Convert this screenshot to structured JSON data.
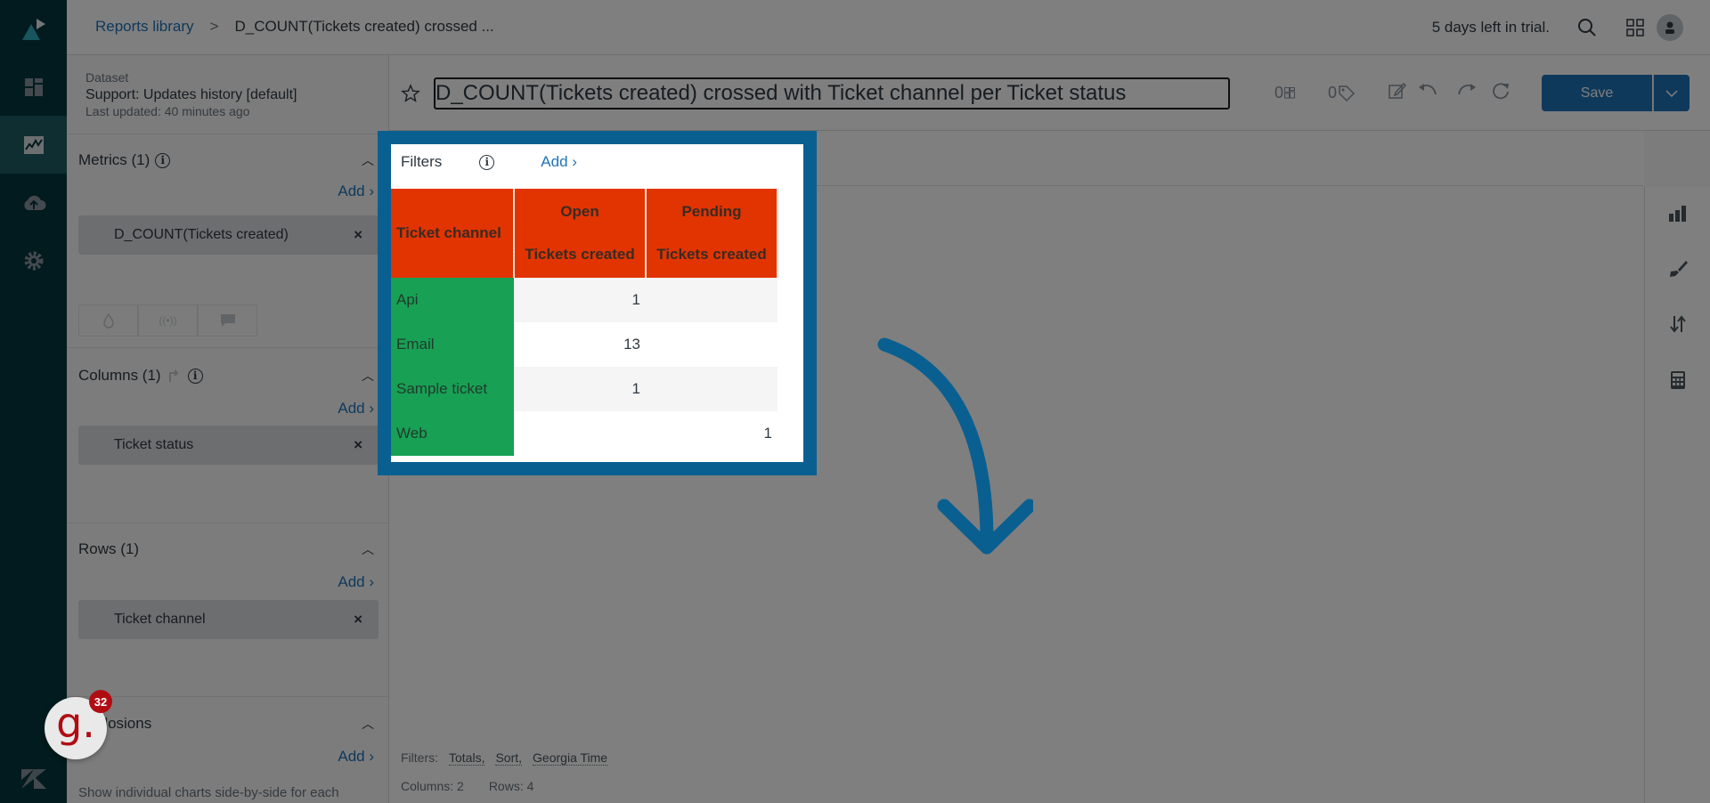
{
  "topbar": {
    "breadcrumb": {
      "root": "Reports library",
      "separator": ">",
      "current": "D_COUNT(Tickets created) crossed ..."
    },
    "trial_text": "5 days left in trial."
  },
  "nav": {
    "items": [
      "logo",
      "dashboards",
      "reports",
      "datasets-upload",
      "settings"
    ],
    "active": "reports"
  },
  "dataset": {
    "label": "Dataset",
    "name": "Support: Updates history [default]",
    "last_updated": "Last updated: 40 minutes ago"
  },
  "sidebar": {
    "metrics": {
      "title": "Metrics (1)",
      "add": "Add ›",
      "items": [
        "D_COUNT(Tickets created)"
      ]
    },
    "columns": {
      "title": "Columns (1)",
      "add": "Add ›",
      "items": [
        "Ticket status"
      ]
    },
    "rows": {
      "title": "Rows (1)",
      "add": "Add ›",
      "items": [
        "Ticket channel"
      ]
    },
    "explosions": {
      "title": "Explosions",
      "add": "Add ›",
      "description": "Show individual charts side-by-side for each"
    }
  },
  "toolbar": {
    "report_title": "D_COUNT(Tickets created) crossed with Ticket channel per Ticket status",
    "widgets_count": "0",
    "tags_count": "0",
    "save_label": "Save"
  },
  "filters_panel": {
    "label": "Filters",
    "add": "Add ›"
  },
  "table": {
    "row_header": "Ticket channel",
    "columns": [
      {
        "status": "Open",
        "metric": "Tickets created"
      },
      {
        "status": "Pending",
        "metric": "Tickets created"
      }
    ],
    "rows": [
      {
        "channel": "Api",
        "values": [
          "1",
          ""
        ]
      },
      {
        "channel": "Email",
        "values": [
          "13",
          ""
        ]
      },
      {
        "channel": "Sample ticket",
        "values": [
          "1",
          ""
        ]
      },
      {
        "channel": "Web",
        "values": [
          "",
          "1"
        ]
      }
    ]
  },
  "footer": {
    "filters_label": "Filters:",
    "filter_links": [
      "Totals,",
      "Sort,",
      "Georgia Time"
    ],
    "columns": "Columns: 2",
    "rows": "Rows: 4"
  },
  "guide_widget": {
    "letter": "g.",
    "badge_count": "32"
  },
  "colors": {
    "nav_bg": "#03363d",
    "accent_blue": "#1f73b7",
    "highlight_frame": "#0a5f91",
    "header_red": "#e23400",
    "row_green": "#18a055"
  }
}
